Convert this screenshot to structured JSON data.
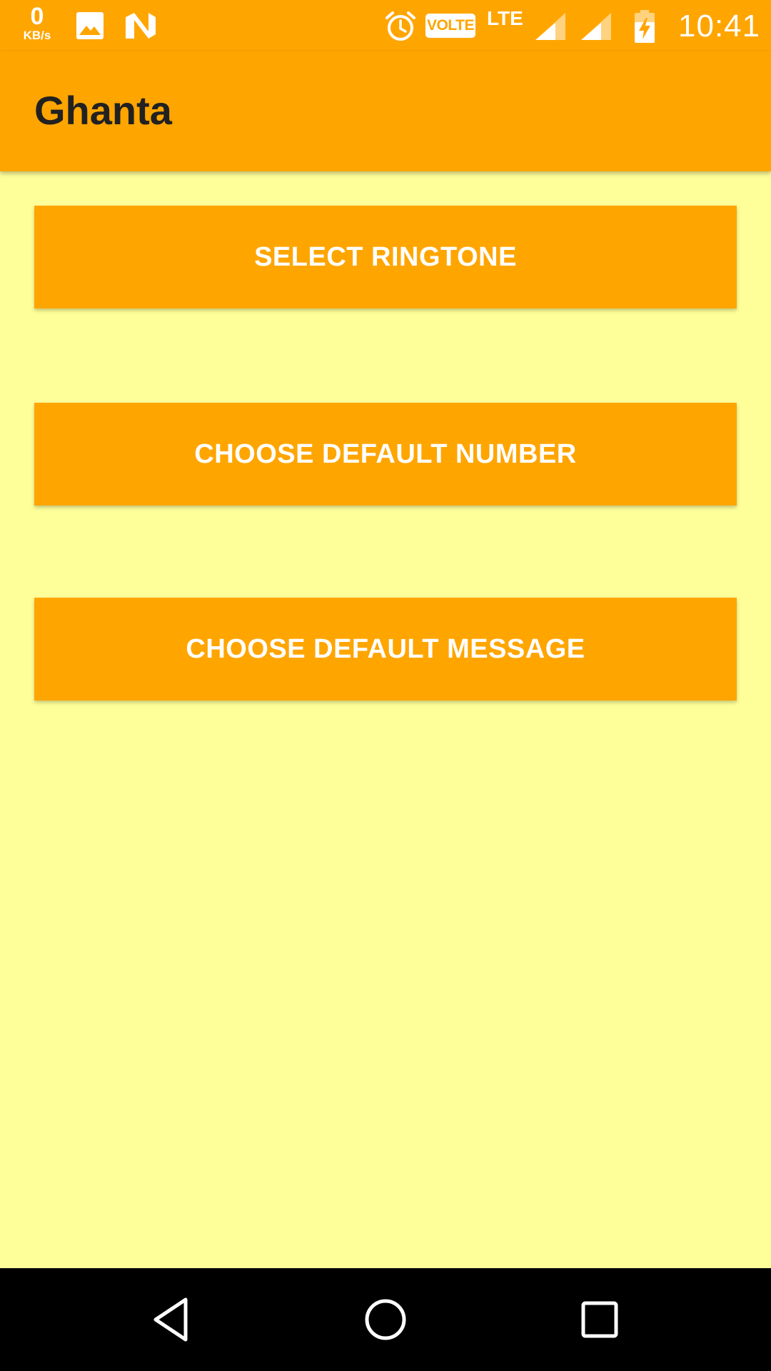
{
  "status_bar": {
    "net_speed_value": "0",
    "net_speed_unit": "KB/s",
    "volte_label": "VOLTE",
    "lte_label": "LTE",
    "time": "10:41",
    "icons": [
      "image-notification-icon",
      "n-notification-icon",
      "alarm-icon",
      "volte-icon",
      "signal-icon",
      "signal-icon",
      "battery-charging-icon"
    ]
  },
  "app_bar": {
    "title": "Ghanta"
  },
  "actions": {
    "select_ringtone": "SELECT RINGTONE",
    "choose_default_number": "CHOOSE DEFAULT NUMBER",
    "choose_default_message": "CHOOSE DEFAULT MESSAGE"
  },
  "nav_bar": {
    "icons": [
      "back-icon",
      "home-icon",
      "recents-icon"
    ]
  },
  "colors": {
    "primary": "#FFA500",
    "background": "#FFFF99",
    "title_text": "#212121",
    "button_text": "#FFFFFF",
    "nav_bar": "#000000"
  }
}
